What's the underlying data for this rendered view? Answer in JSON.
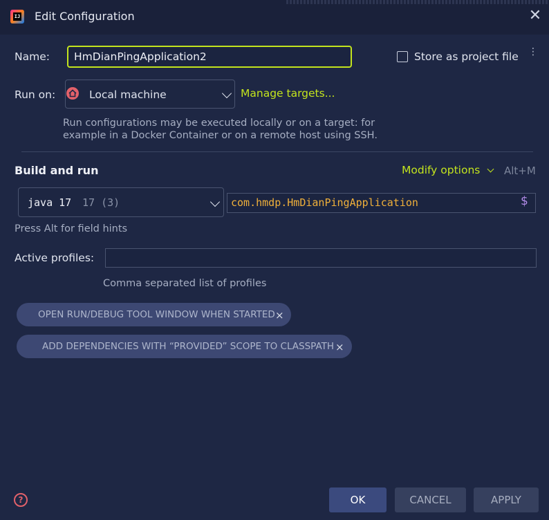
{
  "window": {
    "title": "Edit Configuration"
  },
  "name_field": {
    "label": "Name:",
    "value": "HmDianPingApplication2"
  },
  "store_project": {
    "label": "Store as project file",
    "checked": false
  },
  "run_on": {
    "label": "Run on:",
    "value": "Local machine",
    "manage_link": "Manage targets...",
    "hint_line1": "Run configurations may be executed locally or on a target: for",
    "hint_line2": "example in a Docker Container or on a remote host using SSH."
  },
  "build_run": {
    "title": "Build and run",
    "modify_options": "Modify options",
    "shortcut": "Alt+M",
    "jdk_name": "java 17",
    "jdk_version": "17 (3)",
    "main_class": "com.hmdp.HmDianPingApplication",
    "field_hint": "Press Alt for field hints"
  },
  "profiles": {
    "label": "Active profiles:",
    "value": "",
    "hint": "Comma separated list of profiles"
  },
  "chips": [
    "OPEN RUN/DEBUG TOOL WINDOW WHEN STARTED",
    "ADD DEPENDENCIES WITH “PROVIDED” SCOPE TO CLASSPATH"
  ],
  "footer": {
    "ok": "OK",
    "cancel": "CANCEL",
    "apply": "APPLY"
  },
  "colors": {
    "accent": "#c3e41d",
    "main_class": "#f0b03a",
    "primary_button": "#3b4a7e",
    "background": "#1e2744"
  },
  "icons": {
    "logo": "intellij-idea-logo",
    "close": "close-icon",
    "more": "kebab-icon",
    "run_on": "home-icon",
    "help": "help-icon"
  }
}
